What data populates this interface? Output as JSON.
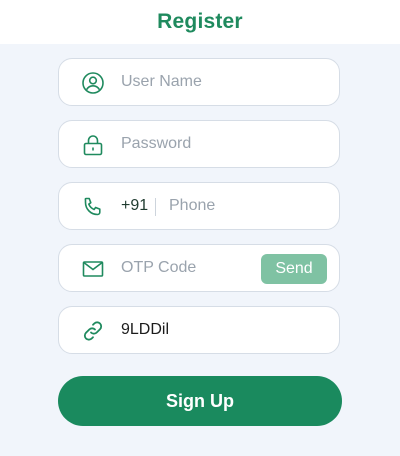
{
  "header": {
    "title": "Register"
  },
  "form": {
    "username": {
      "placeholder": "User Name",
      "icon": "user-icon"
    },
    "password": {
      "placeholder": "Password",
      "icon": "lock-icon"
    },
    "phone": {
      "country_code": "+91",
      "placeholder": "Phone",
      "icon": "phone-icon"
    },
    "otp": {
      "placeholder": "OTP Code",
      "icon": "mail-icon",
      "send_label": "Send"
    },
    "captcha": {
      "value": "9LDDil",
      "icon": "link-icon"
    },
    "submit_label": "Sign Up"
  },
  "colors": {
    "accent": "#1a8a5e",
    "send_button": "#7fc2a3",
    "background": "#f1f5fb"
  }
}
